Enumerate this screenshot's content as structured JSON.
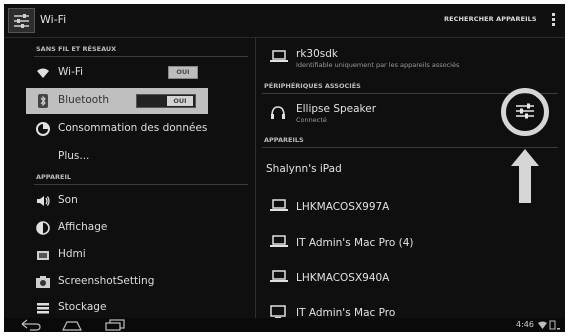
{
  "action_bar": {
    "title": "Wi-Fi",
    "action_label": "RECHERCHER APPAREILS",
    "app_icon": "settings-sliders-icon",
    "overflow_icon": "overflow-menu-icon"
  },
  "left_pane": {
    "section_wireless": "SANS FIL ET RÉSEAUX",
    "section_device": "APPAREIL",
    "items": [
      {
        "label": "Wi-Fi",
        "icon": "wifi-icon",
        "toggle": "OUI"
      },
      {
        "label": "Bluetooth",
        "icon": "bluetooth-icon",
        "toggle": "OUI"
      },
      {
        "label": "Consommation des données",
        "icon": "data-usage-icon"
      },
      {
        "label": "Plus..."
      },
      {
        "label": "Son",
        "icon": "sound-icon"
      },
      {
        "label": "Affichage",
        "icon": "display-icon"
      },
      {
        "label": "Hdmi",
        "icon": "hdmi-icon"
      },
      {
        "label": "ScreenshotSetting",
        "icon": "camera-icon"
      },
      {
        "label": "Stockage",
        "icon": "storage-icon"
      }
    ]
  },
  "right_pane": {
    "this_device": {
      "name": "rk30sdk",
      "sub": "Identifiable uniquement par les appareils associés"
    },
    "section_paired": "PÉRIPHÉRIQUES ASSOCIÉS",
    "paired": [
      {
        "name": "Ellipse Speaker",
        "sub": "Connecté",
        "icon": "headphones-icon",
        "settings_icon": "device-settings-icon"
      }
    ],
    "section_available": "APPAREILS",
    "available": [
      {
        "name": "Shalynn's iPad"
      },
      {
        "name": "LHKMACOSX997A",
        "icon": "laptop-icon"
      },
      {
        "name": "IT Admin's Mac Pro (4)",
        "icon": "laptop-icon"
      },
      {
        "name": "LHKMACOSX940A",
        "icon": "laptop-icon"
      },
      {
        "name": "IT Admin's Mac Pro",
        "icon": "monitor-icon"
      }
    ]
  },
  "nav_bar": {
    "back_icon": "back-icon",
    "home_icon": "home-icon",
    "recents_icon": "recents-icon",
    "time": "4:46"
  },
  "colors": {
    "background": "#0f0f0f",
    "text": "#e2e2e2",
    "section_header": "#bcbcbc",
    "selection": "#bfbfbf",
    "annotation": "#d6d6d6"
  }
}
